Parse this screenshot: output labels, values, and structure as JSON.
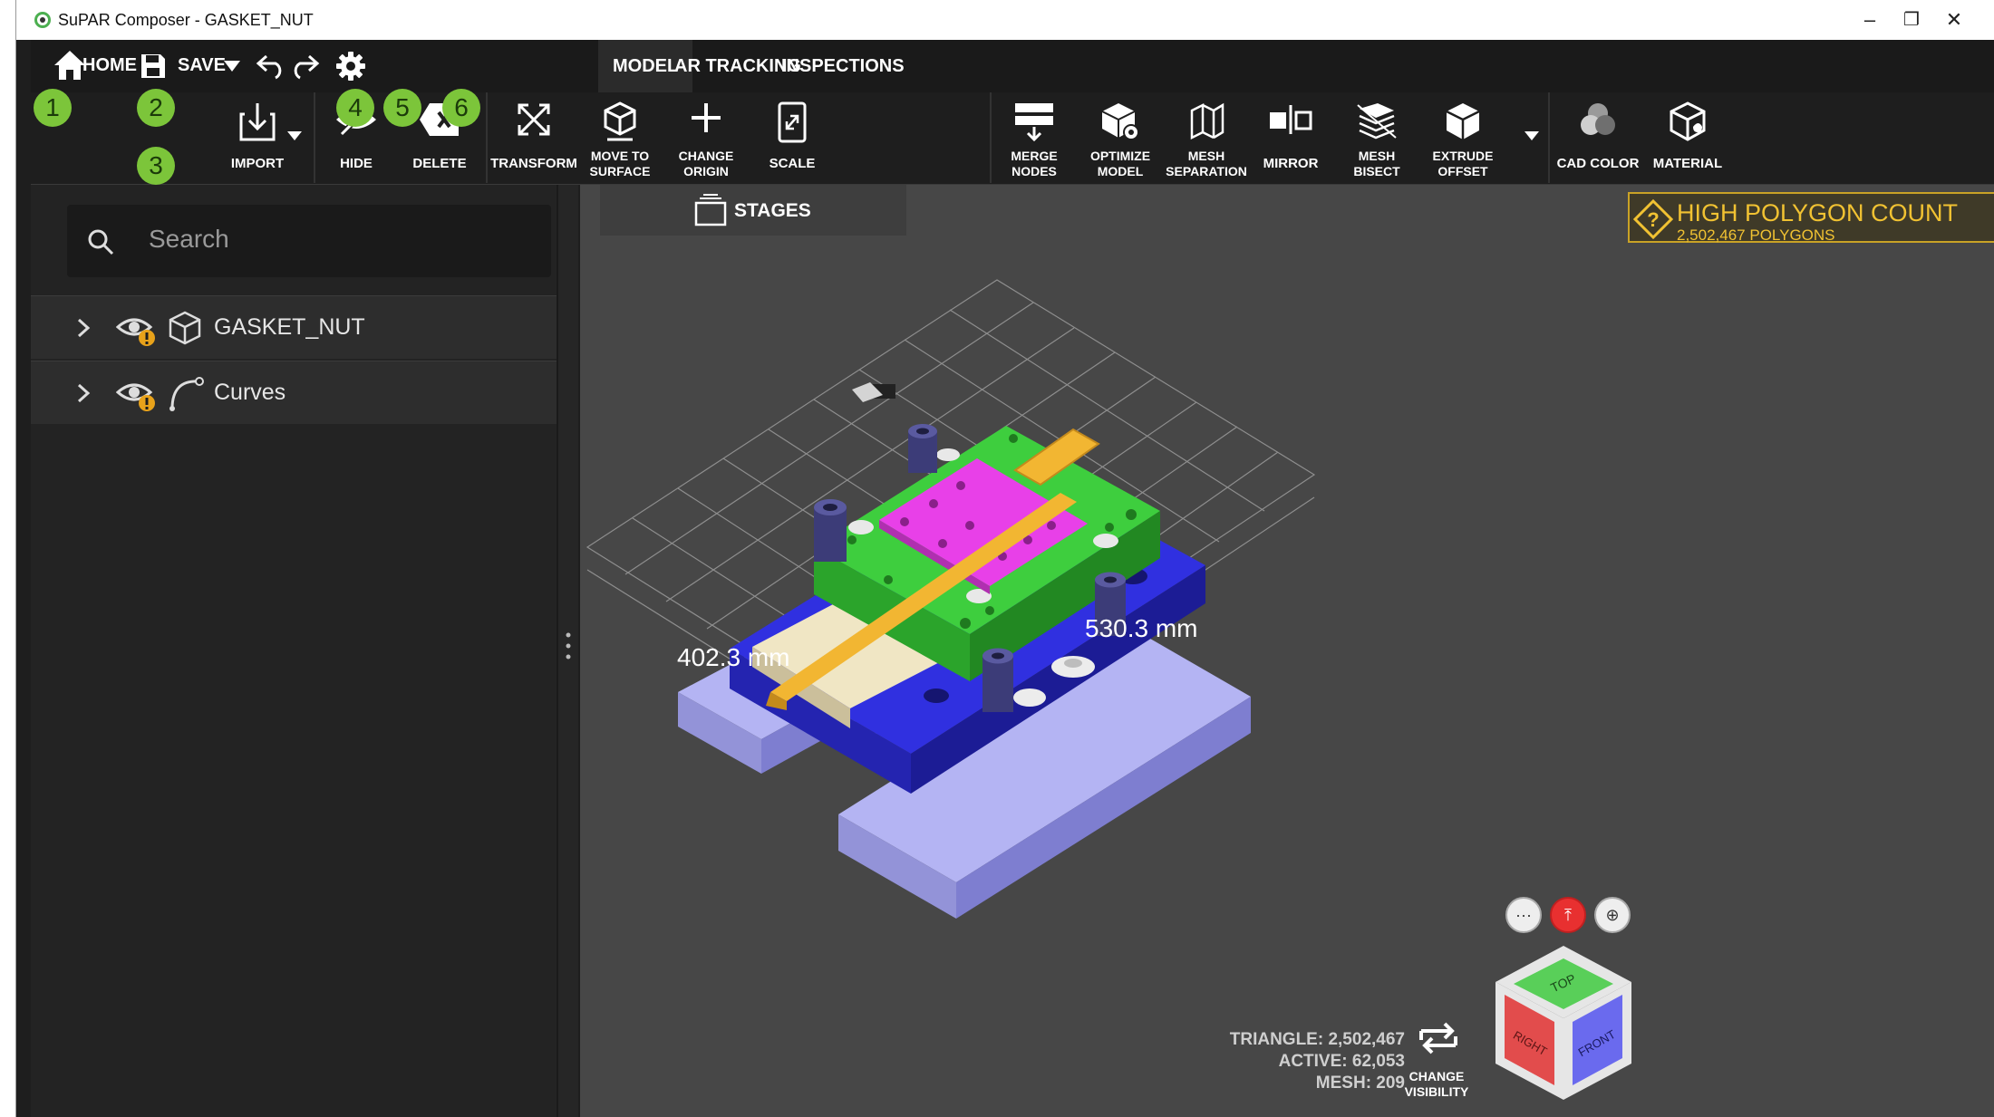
{
  "window": {
    "title": "SuPAR Composer - GASKET_NUT",
    "min": "–",
    "restore": "❐",
    "close": "✕"
  },
  "topbar": {
    "home": "HOME",
    "save": "SAVE",
    "tabs": [
      {
        "label": "MODEL",
        "active": true
      },
      {
        "label": "AR TRACKING",
        "active": false
      },
      {
        "label": "INSPECTIONS",
        "active": false
      }
    ]
  },
  "badges": [
    "1",
    "2",
    "3",
    "4",
    "5",
    "6"
  ],
  "ribbon": {
    "import": "IMPORT",
    "hide": "HIDE",
    "delete": "DELETE",
    "transform": "TRANSFORM",
    "move_to_surface": [
      "MOVE TO",
      "SURFACE"
    ],
    "change_origin": [
      "CHANGE",
      "ORIGIN"
    ],
    "scale": "SCALE",
    "merge_nodes": [
      "MERGE",
      "NODES"
    ],
    "optimize_model": [
      "OPTIMIZE",
      "MODEL"
    ],
    "mesh_separation": [
      "MESH",
      "SEPARATION"
    ],
    "mirror": "MIRROR",
    "mesh_bisect": [
      "MESH",
      "BISECT"
    ],
    "extrude_offset": [
      "EXTRUDE",
      "OFFSET"
    ],
    "cad_color": "CAD COLOR",
    "material": "MATERIAL"
  },
  "sidebar": {
    "search_placeholder": "Search",
    "items": [
      {
        "label": "GASKET_NUT",
        "icon": "cube-icon"
      },
      {
        "label": "Curves",
        "icon": "curve-icon"
      }
    ]
  },
  "viewport": {
    "stages": "STAGES",
    "warning_title": "HIGH POLYGON COUNT",
    "warning_sub": "2,502,467 POLYGONS",
    "dim_x": "402.3 mm",
    "dim_y": "530.3 mm",
    "stats": {
      "triangle": "TRIANGLE: 2,502,467",
      "active": "ACTIVE: 62,053",
      "mesh": "MESH: 209"
    },
    "change_visibility": [
      "CHANGE",
      "VISIBILITY"
    ],
    "cube_faces": {
      "top": "TOP",
      "right": "RIGHT",
      "front": "FRONT"
    }
  },
  "colors": {
    "accent_badge": "#7cc53a",
    "warning": "#f1c232",
    "base_plate": "#2b2bd6",
    "green_plate": "#3cc23c",
    "magenta_plate": "#e03ee0",
    "yellow_part": "#f2b632"
  }
}
